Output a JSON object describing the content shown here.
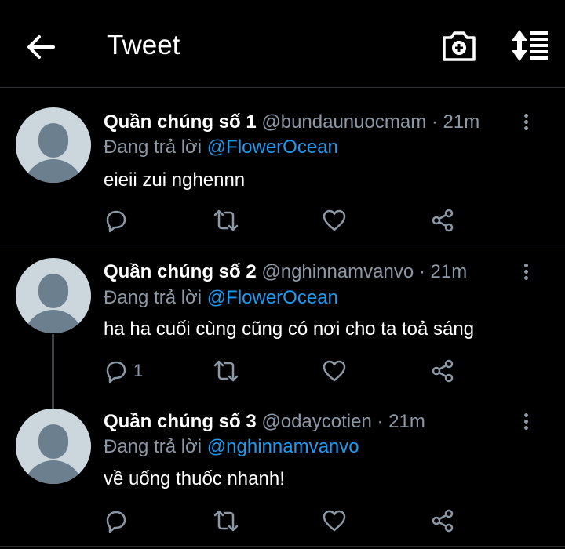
{
  "header": {
    "title": "Tweet"
  },
  "replies": [
    {
      "name": "Quần chúng số 1",
      "handle": "@bundaunuocmam",
      "separator": "·",
      "time": "21m",
      "replying_prefix": "Đang trả lời",
      "replying_to": "@FlowerOcean",
      "text": "eieii zui nghennn",
      "reply_count": ""
    },
    {
      "name": "Quần chúng số 2",
      "handle": "@nghinnamvanvo",
      "separator": "·",
      "time": "21m",
      "replying_prefix": "Đang trả lời",
      "replying_to": "@FlowerOcean",
      "text": "ha ha cuối cùng cũng có nơi cho ta toả sáng",
      "reply_count": "1"
    },
    {
      "name": "Quần chúng số 3",
      "handle": "@odaycotien",
      "separator": "·",
      "time": "21m",
      "replying_prefix": "Đang trả lời",
      "replying_to": "@nghinnamvanvo",
      "text": "về uống thuốc nhanh!",
      "reply_count": ""
    }
  ],
  "colors": {
    "background": "#000000",
    "accent": "#1d9bf0",
    "muted": "#8b98a5",
    "divider": "#2f3336"
  },
  "icons": [
    "back-arrow-icon",
    "camera-plus-icon",
    "sort-icon",
    "more-vertical-icon",
    "reply-icon",
    "retweet-icon",
    "like-icon",
    "share-icon"
  ]
}
